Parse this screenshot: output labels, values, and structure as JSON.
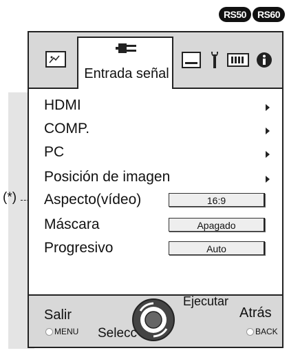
{
  "badges": [
    "RS50",
    "RS60"
  ],
  "tabs": {
    "active_label": "Entrada señal"
  },
  "menu": {
    "items": [
      {
        "label": "HDMI"
      },
      {
        "label": "COMP."
      },
      {
        "label": "PC"
      },
      {
        "label": "Posición de imagen"
      },
      {
        "label": "Aspecto(vídeo)",
        "value": "16:9"
      },
      {
        "label": "Máscara",
        "value": "Apagado"
      },
      {
        "label": "Progresivo",
        "value": "Auto"
      }
    ]
  },
  "annotation": "(*)",
  "bottom": {
    "exit_label": "Salir",
    "exit_key": "MENU",
    "select_label": "Selecc",
    "execute_label": "Ejecutar",
    "back_label": "Atrás",
    "back_key": "BACK"
  }
}
